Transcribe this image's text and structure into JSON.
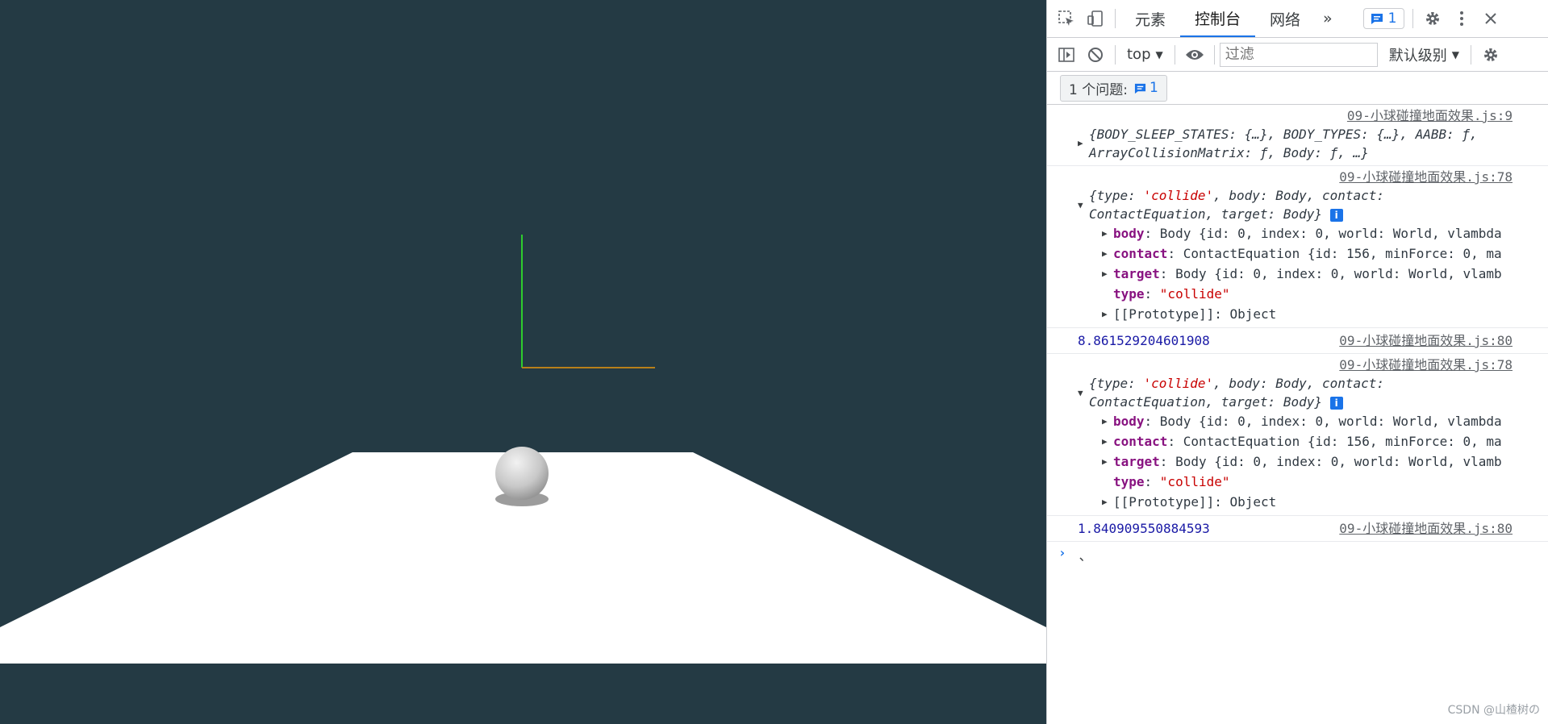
{
  "devtools": {
    "tabs": [
      "元素",
      "控制台",
      "网络"
    ],
    "more_tabs": "»",
    "issue_badge_count": "1",
    "toolbar": {
      "context": "top",
      "filter_placeholder": "过滤",
      "level": "默认级别"
    },
    "issues_label": "1 个问题:",
    "issues_count": "1",
    "logs": [
      {
        "source": "09-小球碰撞地面效果.js:9",
        "text": "{BODY_SLEEP_STATES: {…}, BODY_TYPES: {…}, AABB: ƒ, ArrayCollisionMatrix: ƒ, Body: ƒ, …}"
      },
      {
        "source": "09-小球碰撞地面效果.js:78",
        "summary_a": "{type: ",
        "summary_str": "'collide'",
        "summary_b": ", body: Body, contact: ContactEquation, target: Body}",
        "props": [
          {
            "key": "body",
            "rest": ": Body {id: 0, index: 0, world: World, vlambda"
          },
          {
            "key": "contact",
            "rest": ": ContactEquation {id: 156, minForce: 0, ma"
          },
          {
            "key": "target",
            "rest": ": Body {id: 0, index: 0, world: World, vlamb"
          },
          {
            "key": "type",
            "rest": ": ",
            "str": "\"collide\""
          },
          {
            "key": "[[Prototype]]",
            "rest": ": Object"
          }
        ]
      },
      {
        "source": "09-小球碰撞地面效果.js:80",
        "value": "8.861529204601908"
      },
      {
        "source": "09-小球碰撞地面效果.js:78",
        "summary_a": "{type: ",
        "summary_str": "'collide'",
        "summary_b": ", body: Body, contact: ContactEquation, target: Body}",
        "props": [
          {
            "key": "body",
            "rest": ": Body {id: 0, index: 0, world: World, vlambda"
          },
          {
            "key": "contact",
            "rest": ": ContactEquation {id: 156, minForce: 0, ma"
          },
          {
            "key": "target",
            "rest": ": Body {id: 0, index: 0, world: World, vlamb"
          },
          {
            "key": "type",
            "rest": ": ",
            "str": "\"collide\""
          },
          {
            "key": "[[Prototype]]",
            "rest": ": Object"
          }
        ]
      },
      {
        "source": "09-小球碰撞地面效果.js:80",
        "value": "1.840909550884593"
      }
    ],
    "prompt_text": "、"
  },
  "watermark": "CSDN @山楂树の",
  "colors": {
    "scene_bg": "#243a44",
    "plane": "#ffffff",
    "accent": "#1a73e8"
  }
}
